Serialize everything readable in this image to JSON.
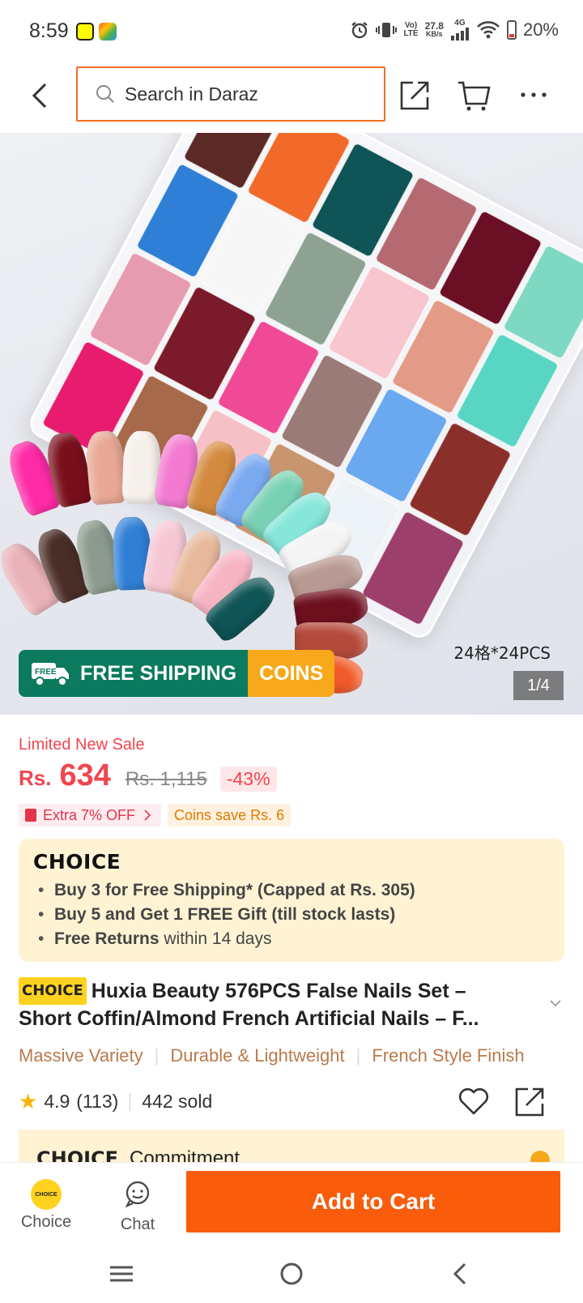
{
  "status_bar": {
    "time": "8:59",
    "net_label_top": "Vo)",
    "net_label_bottom": "LTE",
    "speed_value": "27.8",
    "speed_unit": "KB/s",
    "network_type": "4G",
    "battery": "20%",
    "icons": [
      "snapchat-icon",
      "app-icon",
      "alarm-icon",
      "vibrate-icon",
      "signal-icon",
      "wifi-icon",
      "battery-icon"
    ]
  },
  "top_nav": {
    "search_placeholder": "Search in Daraz",
    "icons": [
      "back-icon",
      "search-icon",
      "share-icon",
      "cart-icon",
      "more-icon"
    ]
  },
  "hero": {
    "caption": "24格*24PCS",
    "counter": "1/4",
    "shipping_label": "FREE SHIPPING",
    "truck_label": "FREE",
    "coins_label": "COINS"
  },
  "price": {
    "sale_label": "Limited New Sale",
    "currency": "Rs.",
    "current": "634",
    "original": "Rs. 1,115",
    "discount": "-43%",
    "extra_off": "Extra 7% OFF",
    "coins_save": "Coins save Rs. 6"
  },
  "choice": {
    "logo": "CHOICE",
    "items": [
      {
        "bold": "Buy 3 for  Free Shipping* (Capped at Rs. 305)",
        "rest": ""
      },
      {
        "bold": "Buy 5 and Get 1 FREE Gift (till stock lasts)",
        "rest": ""
      },
      {
        "bold": "Free Returns",
        "rest": " within 14 days"
      }
    ]
  },
  "product": {
    "badge": "CHOICE",
    "title_line1": "Huxia Beauty 576PCS False Nails Set –",
    "title_line2": "Short Coffin/Almond French Artificial Nails – F...",
    "features": [
      "Massive Variety",
      "Durable & Lightweight",
      "French Style Finish"
    ],
    "rating": "4.9",
    "reviews": "(113)",
    "sold": "442 sold"
  },
  "commitment": {
    "logo": "CHOICE",
    "label": "Commitment"
  },
  "bottom_bar": {
    "choice_label": "Choice",
    "choice_icon_text": "CHOICE",
    "chat_label": "Chat",
    "add_to_cart": "Add to Cart"
  },
  "colors": {
    "accent": "#f95c0a",
    "price": "#f0454f",
    "shipping_green": "#0b7a5e",
    "coins_orange": "#f7a81b",
    "choice_bg": "#fff3d4",
    "feature_text": "#b97a4c"
  }
}
